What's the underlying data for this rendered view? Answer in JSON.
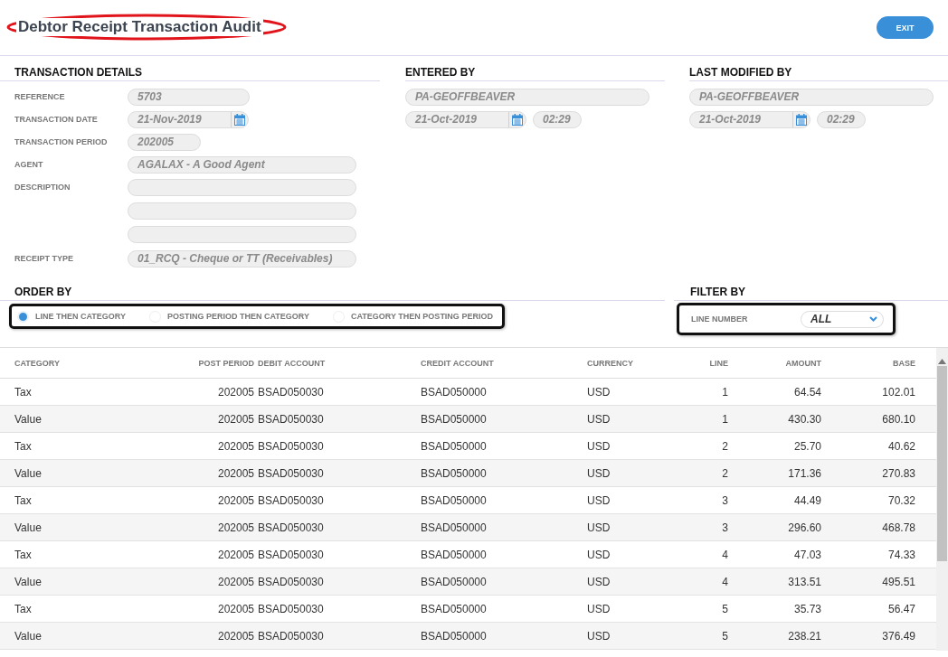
{
  "title": "Debtor Receipt Transaction Audit",
  "exit_button": "EXIT",
  "transaction_details": {
    "heading": "TRANSACTION DETAILS",
    "fields": [
      {
        "label": "REFERENCE",
        "value": "5703",
        "kind": "narrow"
      },
      {
        "label": "TRANSACTION DATE",
        "value": "21-Nov-2019",
        "kind": "date"
      },
      {
        "label": "TRANSACTION PERIOD",
        "value": "202005",
        "kind": "short"
      },
      {
        "label": "AGENT",
        "value": "AGALAX - A Good Agent",
        "kind": "wide"
      },
      {
        "label": "DESCRIPTION",
        "kind": "multiline"
      },
      {
        "label": "RECEIPT TYPE",
        "value": "01_RCQ - Cheque or TT (Receivables)",
        "kind": "wide"
      }
    ]
  },
  "entered_by": {
    "heading": "ENTERED BY",
    "user": "PA-GEOFFBEAVER",
    "date": "21-Oct-2019",
    "time": "02:29"
  },
  "last_modified_by": {
    "heading": "LAST MODIFIED BY",
    "user": "PA-GEOFFBEAVER",
    "date": "21-Oct-2019",
    "time": "02:29"
  },
  "order_by": {
    "heading": "ORDER BY",
    "options": [
      {
        "label": "LINE THEN CATEGORY",
        "selected": true
      },
      {
        "label": "POSTING PERIOD THEN CATEGORY",
        "selected": false
      },
      {
        "label": "CATEGORY THEN POSTING PERIOD",
        "selected": false
      }
    ]
  },
  "filter_by": {
    "heading": "FILTER BY",
    "label": "LINE NUMBER",
    "value": "ALL"
  },
  "table": {
    "columns": [
      "CATEGORY",
      "POST PERIOD",
      "DEBIT ACCOUNT",
      "CREDIT ACCOUNT",
      "CURRENCY",
      "LINE",
      "AMOUNT",
      "BASE"
    ],
    "rows": [
      [
        "Tax",
        "202005",
        "BSAD050030",
        "BSAD050000",
        "USD",
        "1",
        "64.54",
        "102.01"
      ],
      [
        "Value",
        "202005",
        "BSAD050030",
        "BSAD050000",
        "USD",
        "1",
        "430.30",
        "680.10"
      ],
      [
        "Tax",
        "202005",
        "BSAD050030",
        "BSAD050000",
        "USD",
        "2",
        "25.70",
        "40.62"
      ],
      [
        "Value",
        "202005",
        "BSAD050030",
        "BSAD050000",
        "USD",
        "2",
        "171.36",
        "270.83"
      ],
      [
        "Tax",
        "202005",
        "BSAD050030",
        "BSAD050000",
        "USD",
        "3",
        "44.49",
        "70.32"
      ],
      [
        "Value",
        "202005",
        "BSAD050030",
        "BSAD050000",
        "USD",
        "3",
        "296.60",
        "468.78"
      ],
      [
        "Tax",
        "202005",
        "BSAD050030",
        "BSAD050000",
        "USD",
        "4",
        "47.03",
        "74.33"
      ],
      [
        "Value",
        "202005",
        "BSAD050030",
        "BSAD050000",
        "USD",
        "4",
        "313.51",
        "495.51"
      ],
      [
        "Tax",
        "202005",
        "BSAD050030",
        "BSAD050000",
        "USD",
        "5",
        "35.73",
        "56.47"
      ],
      [
        "Value",
        "202005",
        "BSAD050030",
        "BSAD050000",
        "USD",
        "5",
        "238.21",
        "376.49"
      ]
    ]
  }
}
